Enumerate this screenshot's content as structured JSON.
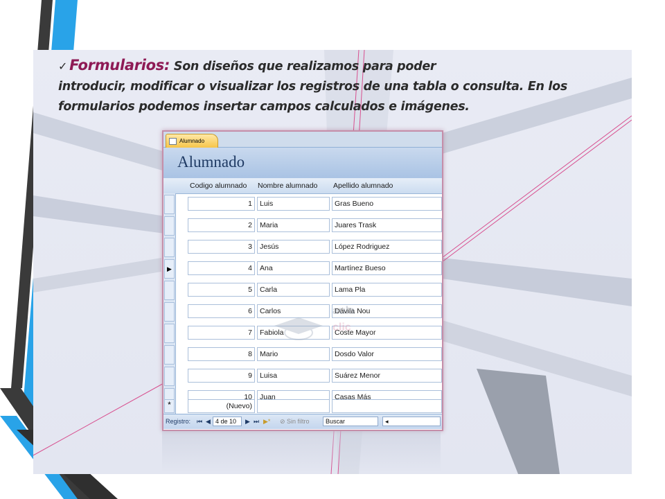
{
  "slide": {
    "heading_check": "✓",
    "heading_keyword": "Formularios:",
    "line1_rest": " Son diseños que realizamos para poder",
    "line2": "introducir, modificar o visualizar los registros de una tabla o consulta. En los",
    "line3": "formularios podemos insertar campos calculados e imágenes."
  },
  "access_form": {
    "tab_label": "Alumnado",
    "form_title": "Alumnado",
    "columns": [
      "Codigo alumnado",
      "Nombre alumnado",
      "Apellido alumnado"
    ],
    "rows": [
      {
        "codigo": "1",
        "nombre": "Luis",
        "apellido": "Gras Bueno"
      },
      {
        "codigo": "2",
        "nombre": "Maria",
        "apellido": "Juares Trask"
      },
      {
        "codigo": "3",
        "nombre": "Jesús",
        "apellido": "López Rodriguez"
      },
      {
        "codigo": "4",
        "nombre": "Ana",
        "apellido": "Martínez Bueso"
      },
      {
        "codigo": "5",
        "nombre": "Carla",
        "apellido": "Lama Pla"
      },
      {
        "codigo": "6",
        "nombre": "Carlos",
        "apellido": "Dávila Nou"
      },
      {
        "codigo": "7",
        "nombre": "Fabiola",
        "apellido": "Coste Mayor"
      },
      {
        "codigo": "8",
        "nombre": "Mario",
        "apellido": "Dosdo Valor"
      },
      {
        "codigo": "9",
        "nombre": "Luisa",
        "apellido": "Suárez Menor"
      },
      {
        "codigo": "10",
        "nombre": "Juan",
        "apellido": "Casas Más"
      }
    ],
    "new_row": {
      "codigo": "(Nuevo)",
      "selector": "*"
    },
    "current_record_marker": "▶",
    "nav": {
      "label": "Registro:",
      "first": "⏮",
      "prev": "◀",
      "position": "4 de 10",
      "next": "▶",
      "last": "⏭",
      "new": "▶*",
      "filter": "Sin filtro",
      "search": "Buscar"
    }
  },
  "watermark": {
    "line1": "aula",
    "line2": "clic"
  },
  "colors": {
    "keyword": "#8e1a55",
    "stripe_blue": "#29a3e8",
    "stripe_dark": "#3a3a3a",
    "window_border": "#c58ea9"
  }
}
